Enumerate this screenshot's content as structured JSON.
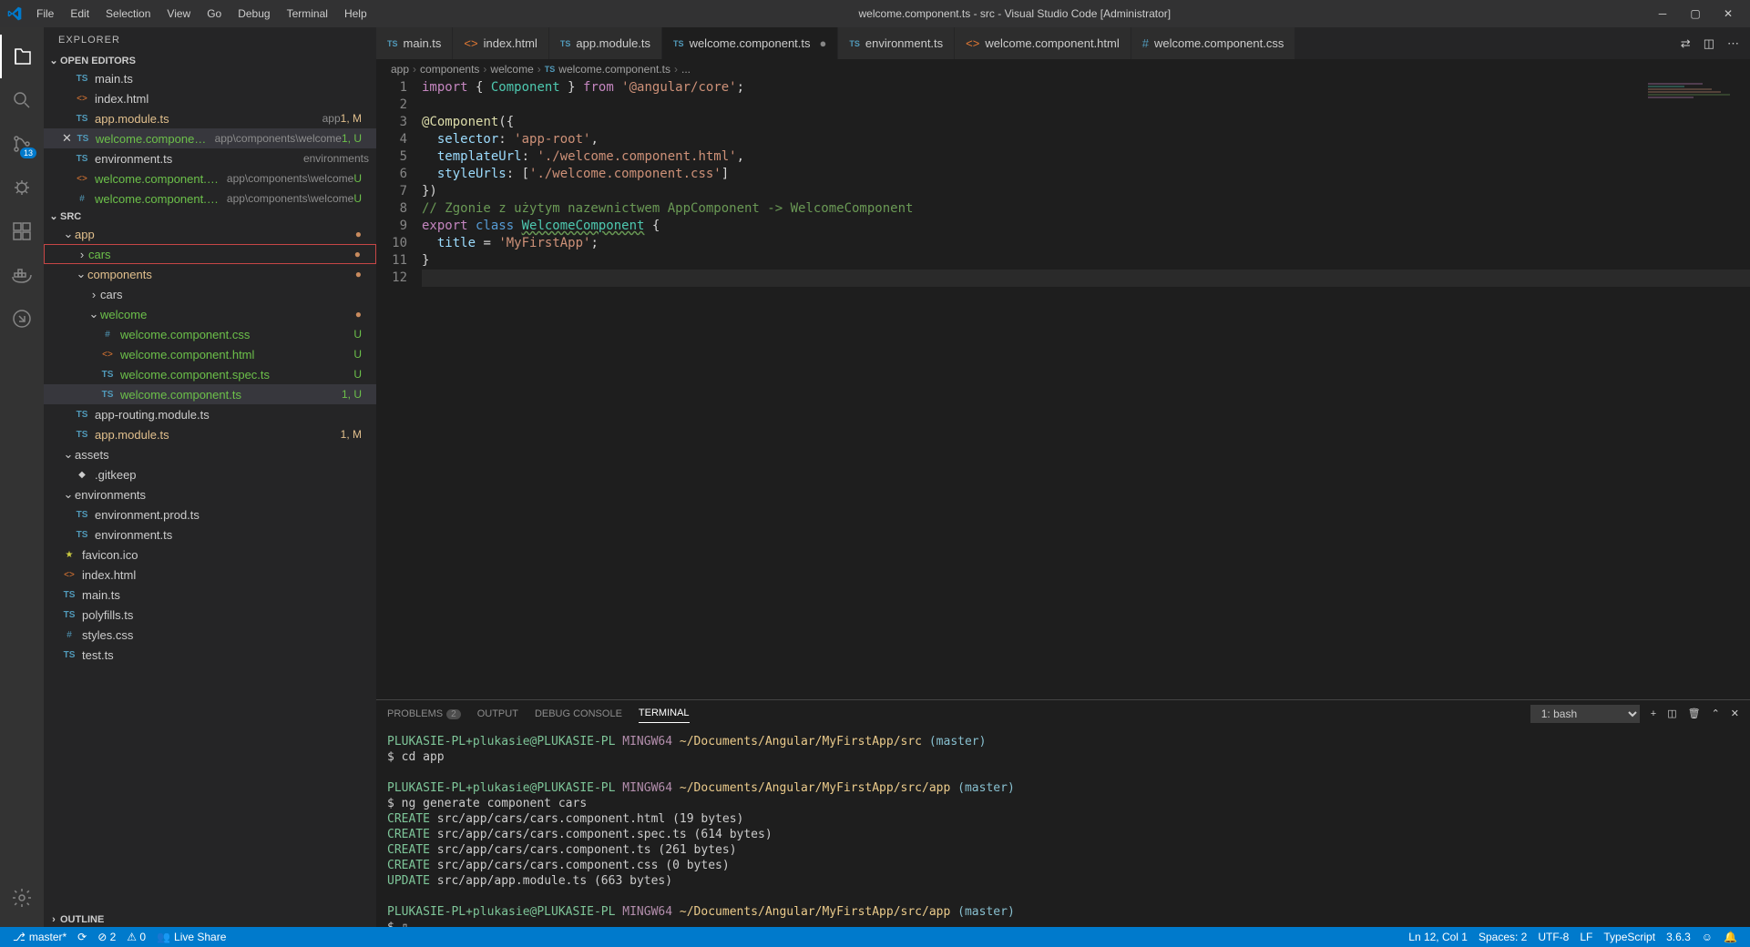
{
  "title": "welcome.component.ts - src - Visual Studio Code [Administrator]",
  "menu": [
    "File",
    "Edit",
    "Selection",
    "View",
    "Go",
    "Debug",
    "Terminal",
    "Help"
  ],
  "sidebar": {
    "title": "EXPLORER",
    "sections": {
      "openEditors": "OPEN EDITORS",
      "src": "SRC",
      "outline": "OUTLINE"
    }
  },
  "openEditors": [
    {
      "icon": "TS",
      "name": "main.ts",
      "sub": "",
      "status": ""
    },
    {
      "icon": "<>",
      "name": "index.html",
      "sub": "",
      "status": ""
    },
    {
      "icon": "TS",
      "name": "app.module.ts",
      "sub": "app",
      "status": "1, M",
      "git": "m"
    },
    {
      "icon": "TS",
      "name": "welcome.component.ts",
      "sub": "app\\components\\welcome",
      "status": "1, U",
      "git": "u",
      "selected": true,
      "close": true
    },
    {
      "icon": "TS",
      "name": "environment.ts",
      "sub": "environments",
      "status": ""
    },
    {
      "icon": "<>",
      "name": "welcome.component.html",
      "sub": "app\\components\\welcome",
      "status": "U",
      "git": "u"
    },
    {
      "icon": "#",
      "name": "welcome.component.css",
      "sub": "app\\components\\welcome",
      "status": "U",
      "git": "u"
    }
  ],
  "tree": [
    {
      "type": "folder",
      "name": "app",
      "indent": 1,
      "open": true,
      "dot": true,
      "git": "m"
    },
    {
      "type": "folder",
      "name": "cars",
      "indent": 2,
      "open": false,
      "dot": true,
      "git": "u",
      "redbox": true
    },
    {
      "type": "folder",
      "name": "components",
      "indent": 2,
      "open": true,
      "dot": true,
      "git": "m"
    },
    {
      "type": "folder",
      "name": "cars",
      "indent": 3,
      "open": false
    },
    {
      "type": "folder",
      "name": "welcome",
      "indent": 3,
      "open": true,
      "dot": true,
      "git": "u"
    },
    {
      "type": "file",
      "icon": "#",
      "name": "welcome.component.css",
      "indent": 4,
      "status": "U",
      "git": "u"
    },
    {
      "type": "file",
      "icon": "<>",
      "name": "welcome.component.html",
      "indent": 4,
      "status": "U",
      "git": "u"
    },
    {
      "type": "file",
      "icon": "TS",
      "name": "welcome.component.spec.ts",
      "indent": 4,
      "status": "U",
      "git": "u"
    },
    {
      "type": "file",
      "icon": "TS",
      "name": "welcome.component.ts",
      "indent": 4,
      "status": "1, U",
      "git": "u",
      "selected": true
    },
    {
      "type": "file",
      "icon": "TS",
      "name": "app-routing.module.ts",
      "indent": 2
    },
    {
      "type": "file",
      "icon": "TS",
      "name": "app.module.ts",
      "indent": 2,
      "status": "1, M",
      "git": "m"
    },
    {
      "type": "folder",
      "name": "assets",
      "indent": 1,
      "open": true
    },
    {
      "type": "file",
      "icon": "◆",
      "name": ".gitkeep",
      "indent": 2
    },
    {
      "type": "folder",
      "name": "environments",
      "indent": 1,
      "open": true
    },
    {
      "type": "file",
      "icon": "TS",
      "name": "environment.prod.ts",
      "indent": 2
    },
    {
      "type": "file",
      "icon": "TS",
      "name": "environment.ts",
      "indent": 2
    },
    {
      "type": "file",
      "icon": "★",
      "name": "favicon.ico",
      "indent": 1,
      "iconColor": "#cbcb41"
    },
    {
      "type": "file",
      "icon": "<>",
      "name": "index.html",
      "indent": 1
    },
    {
      "type": "file",
      "icon": "TS",
      "name": "main.ts",
      "indent": 1
    },
    {
      "type": "file",
      "icon": "TS",
      "name": "polyfills.ts",
      "indent": 1
    },
    {
      "type": "file",
      "icon": "#",
      "name": "styles.css",
      "indent": 1
    },
    {
      "type": "file",
      "icon": "TS",
      "name": "test.ts",
      "indent": 1
    }
  ],
  "tabs": [
    {
      "icon": "TS",
      "name": "main.ts"
    },
    {
      "icon": "<>",
      "name": "index.html"
    },
    {
      "icon": "TS",
      "name": "app.module.ts"
    },
    {
      "icon": "TS",
      "name": "welcome.component.ts",
      "active": true,
      "dirty": true
    },
    {
      "icon": "TS",
      "name": "environment.ts"
    },
    {
      "icon": "<>",
      "name": "welcome.component.html"
    },
    {
      "icon": "#",
      "name": "welcome.component.css"
    }
  ],
  "breadcrumb": [
    "app",
    "components",
    "welcome",
    "welcome.component.ts",
    "..."
  ],
  "code": {
    "lines": 12,
    "l1": {
      "a": "import",
      "b": "{ ",
      "c": "Component",
      "d": " } ",
      "e": "from",
      "f": " '@angular/core'",
      "g": ";"
    },
    "l3": {
      "a": "@",
      "b": "Component",
      "c": "({"
    },
    "l4": {
      "a": "selector",
      "b": ": ",
      "c": "'app-root'",
      "d": ","
    },
    "l5": {
      "a": "templateUrl",
      "b": ": ",
      "c": "'./welcome.component.html'",
      "d": ","
    },
    "l6": {
      "a": "styleUrls",
      "b": ": [",
      "c": "'./welcome.component.css'",
      "d": "]"
    },
    "l7": "})",
    "l8": "// Zgonie z użytym nazewnictwem AppComponent -> WelcomeComponent",
    "l9": {
      "a": "export",
      "b": " class ",
      "c": "WelcomeComponent",
      "d": " {"
    },
    "l10": {
      "a": "title",
      "b": " = ",
      "c": "'MyFirstApp'",
      "d": ";"
    },
    "l11": "}"
  },
  "panel": {
    "tabs": {
      "problems": "PROBLEMS",
      "problemsCount": "2",
      "output": "OUTPUT",
      "debug": "DEBUG CONSOLE",
      "terminal": "TERMINAL"
    },
    "select": "1: bash"
  },
  "terminal": {
    "l1": {
      "user": "PLUKASIE-PL+plukasie@PLUKASIE-PL",
      "sys": "MINGW64",
      "path": "~/Documents/Angular/MyFirstApp/src",
      "branch": "(master)"
    },
    "l2": "$ cd app",
    "l3": {
      "user": "PLUKASIE-PL+plukasie@PLUKASIE-PL",
      "sys": "MINGW64",
      "path": "~/Documents/Angular/MyFirstApp/src/app",
      "branch": "(master)"
    },
    "l4": "$ ng generate component cars",
    "l5": {
      "a": "CREATE",
      "b": " src/app/cars/cars.component.html (19 bytes)"
    },
    "l6": {
      "a": "CREATE",
      "b": " src/app/cars/cars.component.spec.ts (614 bytes)"
    },
    "l7": {
      "a": "CREATE",
      "b": " src/app/cars/cars.component.ts (261 bytes)"
    },
    "l8": {
      "a": "CREATE",
      "b": " src/app/cars/cars.component.css (0 bytes)"
    },
    "l9": {
      "a": "UPDATE",
      "b": " src/app/app.module.ts (663 bytes)"
    },
    "l10": {
      "user": "PLUKASIE-PL+plukasie@PLUKASIE-PL",
      "sys": "MINGW64",
      "path": "~/Documents/Angular/MyFirstApp/src/app",
      "branch": "(master)"
    },
    "l11": "$ ▯"
  },
  "status": {
    "branch": "master*",
    "sync": "⟳",
    "errors": "⊘ 2",
    "warnings": "⚠ 0",
    "liveShare": "Live Share",
    "cursor": "Ln 12, Col 1",
    "spaces": "Spaces: 2",
    "encoding": "UTF-8",
    "eol": "LF",
    "lang": "TypeScript",
    "version": "3.6.3",
    "feedback": "☺",
    "bell": "🔔"
  },
  "scm_badge": "13"
}
